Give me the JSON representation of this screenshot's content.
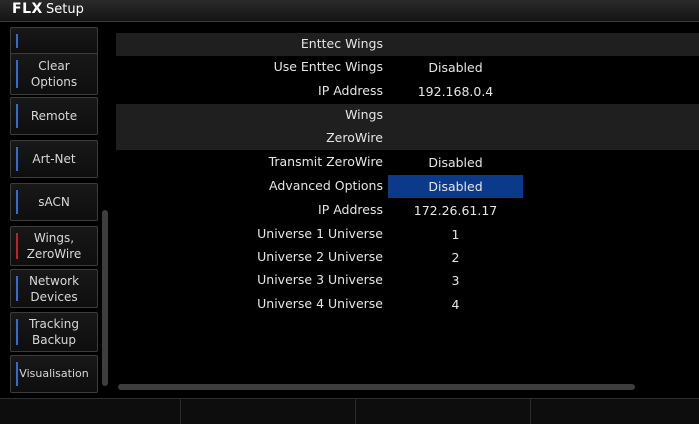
{
  "titlebar": {
    "logo": "FLX",
    "title": "Setup"
  },
  "sidebar": {
    "items": [
      {
        "label": ""
      },
      {
        "label": "Clear\nOptions"
      },
      {
        "label": "Remote"
      },
      {
        "label": "Art-Net"
      },
      {
        "label": "sACN"
      },
      {
        "label": "Wings,\nZeroWire",
        "active": true
      },
      {
        "label": "Network\nDevices"
      },
      {
        "label": "Tracking\nBackup"
      },
      {
        "label": "Visualisation"
      }
    ]
  },
  "settings": {
    "rows": [
      {
        "label": "Enttec Wings",
        "value": "",
        "section": true
      },
      {
        "label": "Use Enttec Wings",
        "value": "Disabled"
      },
      {
        "label": "IP Address",
        "value": "192.168.0.4"
      },
      {
        "label": "Wings",
        "value": "",
        "section": true
      },
      {
        "label": "ZeroWire",
        "value": "",
        "section": true
      },
      {
        "label": "Transmit ZeroWire",
        "value": "Disabled"
      },
      {
        "label": "Advanced Options",
        "value": "Disabled",
        "selected": true
      },
      {
        "label": "IP Address",
        "value": "172.26.61.17"
      },
      {
        "label": "Universe 1 Universe",
        "value": "1"
      },
      {
        "label": "Universe 2 Universe",
        "value": "2"
      },
      {
        "label": "Universe 3 Universe",
        "value": "3"
      },
      {
        "label": "Universe 4 Universe",
        "value": "4"
      }
    ]
  },
  "softkeys": [
    "",
    "",
    "",
    ""
  ],
  "colors": {
    "accent_blue": "#2b6fd6",
    "active_red": "#c0202a",
    "selection": "#0b3a8a"
  }
}
